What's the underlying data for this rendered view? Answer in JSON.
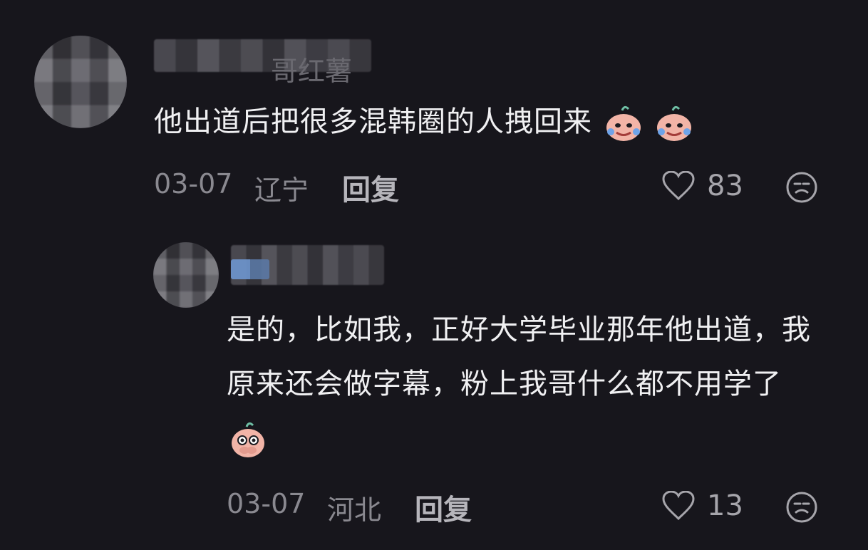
{
  "comments": [
    {
      "user_name": "哥红薯",
      "text": "他出道后把很多混韩圈的人拽回来",
      "emoji_names": [
        "crying-laugh-emoji",
        "crying-laugh-emoji"
      ],
      "date": "03-07",
      "location": "辽宁",
      "reply_label": "回复",
      "likes": "83"
    },
    {
      "text": "是的，比如我，正好大学毕业那年他出道，我原来还会做字幕，粉上我哥什么都不用学了",
      "emoji_names": [
        "peeking-emoji"
      ],
      "date": "03-07",
      "location": "河北",
      "reply_label": "回复",
      "likes": "13"
    }
  ],
  "colors": {
    "background": "#17161c",
    "primary_text": "#f0f0f2",
    "secondary_text": "#8a8990",
    "reply_text": "#b6b5bb",
    "icon": "#a6a5ab"
  }
}
